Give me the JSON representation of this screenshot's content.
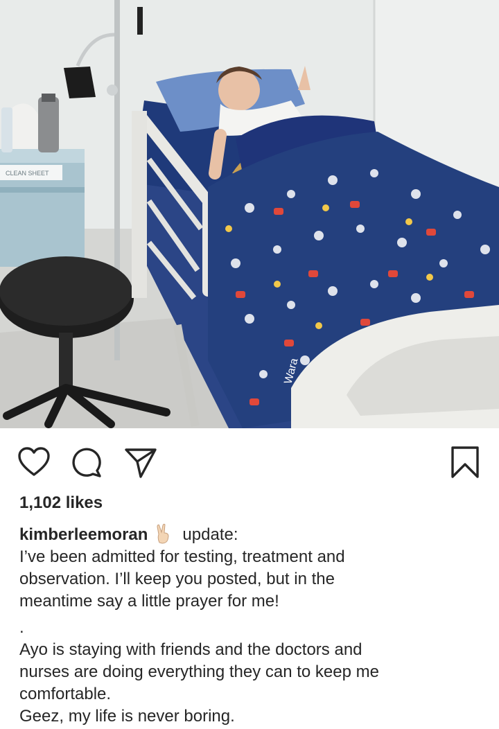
{
  "post": {
    "likes_text": "1,102 likes",
    "username": "kimberleemoran",
    "emoji": "victory-hand",
    "caption_first": "update:",
    "caption_lines": [
      "I’ve been admitted for testing, treatment and",
      "observation. I’ll keep you posted, but in the",
      "meantime say a little prayer for me!",
      ".",
      "Ayo is staying with friends and the doctors and",
      "nurses are doing everything they can to keep me",
      "comfortable.",
      "Geez, my life is never boring."
    ],
    "photo_label": "CLEAN SHEET",
    "blanket_text": "Wara"
  },
  "actions": {
    "like": "heart-icon",
    "comment": "comment-icon",
    "share": "send-icon",
    "save": "bookmark-icon"
  },
  "colors": {
    "text": "#262626",
    "blanket": "#24407e",
    "pillow": "#6d8fc8",
    "sheet": "#1f3a7a"
  }
}
